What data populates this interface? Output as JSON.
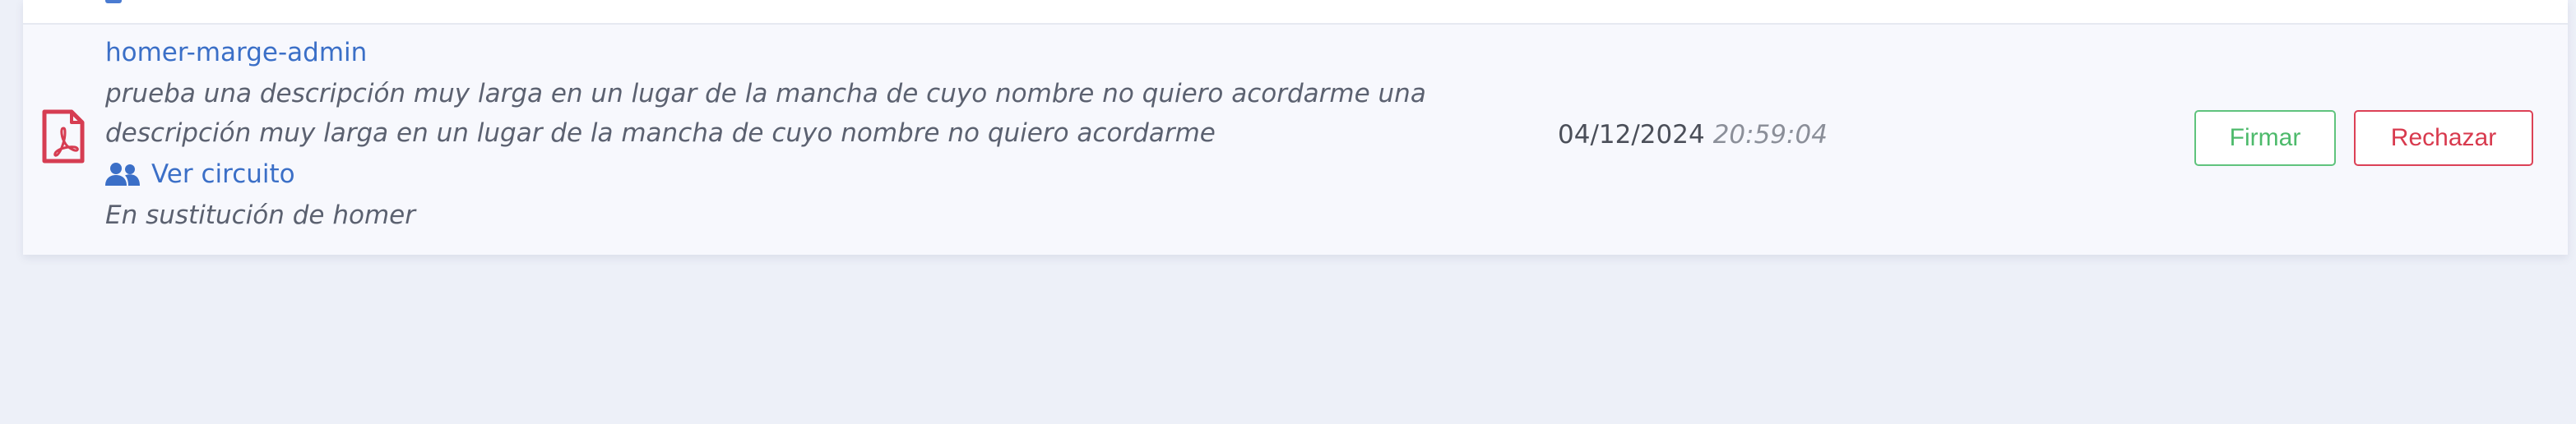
{
  "document": {
    "author": "homer-marge-admin",
    "description": "prueba una descripción muy larga en un lugar de la mancha de cuyo nombre no quiero acordarme una descripción muy larga en un lugar de la mancha de cuyo nombre no quiero acordarme",
    "circuit_link": "Ver circuito",
    "substitution": "En sustitución de homer",
    "date": "04/12/2024",
    "time": "20:59:04",
    "file_icon": "pdf-file-icon",
    "circuit_icon": "users-icon"
  },
  "actions": {
    "sign_label": "Firmar",
    "reject_label": "Rechazar"
  },
  "colors": {
    "link": "#3b6fc7",
    "pdf_icon": "#d63d52",
    "sign": "#4dba6b",
    "reject": "#d83a4e"
  }
}
